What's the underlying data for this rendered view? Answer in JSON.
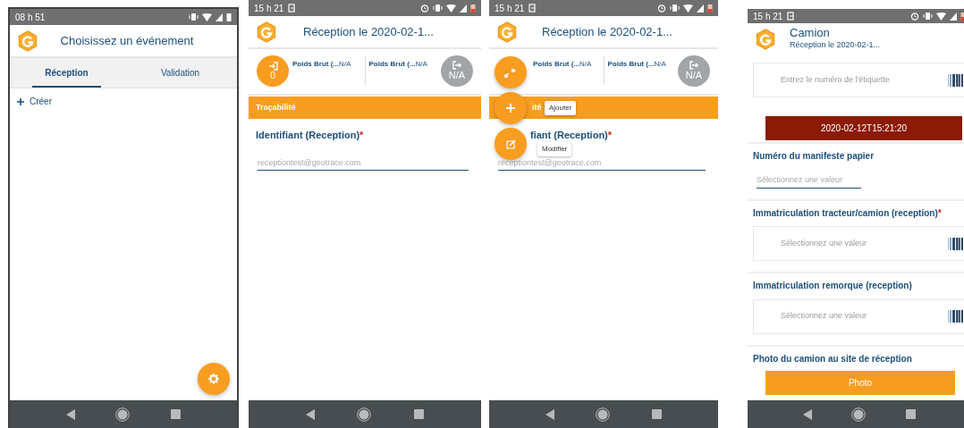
{
  "event_screen": {
    "status_time": "08 h 51",
    "title": "Choisissez un événement",
    "tabs": [
      {
        "label": "Réception",
        "selected": true
      },
      {
        "label": "Validation",
        "selected": false
      }
    ],
    "create_label": "Créer"
  },
  "reception_screen": {
    "status_time": "15 h 21",
    "title": "Réception le 2020-02-1...",
    "entry_reading": "0",
    "weights": [
      {
        "label": "Poids Brut (...",
        "value": "N/A"
      },
      {
        "label": "Poids Brut (...",
        "value": "N/A"
      }
    ],
    "exit_reading": "N/A",
    "section": "Traçabilité",
    "field_label": "Identifiant (Reception)",
    "required_mark": "*",
    "placeholder": "receptiontest@geotrace.com"
  },
  "menu_screen": {
    "status_time": "15 h 21",
    "title": "Réception le 2020-02-1...",
    "weights": [
      {
        "label": "Poids Brut (...",
        "value": "N/A"
      },
      {
        "label": "Poids Brut (...",
        "value": "N/A"
      }
    ],
    "exit_reading": "N/A",
    "section": "ité",
    "field_label": "fiant (Reception)",
    "required_mark": "*",
    "placeholder": "receptiontest@geotrace.com",
    "menu": [
      {
        "label": "Ajouter"
      },
      {
        "label": "Modifier"
      }
    ]
  },
  "truck_screen": {
    "status_time": "15 h 21",
    "title": "Camion",
    "subtitle": "Réception le 2020-02-1...",
    "items": [
      {
        "kind": "scan",
        "placeholder": "Entrez le numéro de l'étiquette"
      },
      {
        "kind": "date",
        "text": "2020-02-12T15:21:20"
      },
      {
        "kind": "line-field",
        "label": "Numéro du manifeste papier",
        "placeholder": "Sélectionnez une valeur"
      },
      {
        "kind": "scan-field",
        "label": "Immatriculation tracteur/camion (reception)",
        "required_mark": "*",
        "placeholder": "Sélectionnez une valeur"
      },
      {
        "kind": "scan-field",
        "label": "Immatriculation remorque (reception)",
        "placeholder": "Sélectionnez une valeur"
      },
      {
        "kind": "photo",
        "label": "Photo du camion au site de réception",
        "button": "Photo"
      }
    ]
  }
}
